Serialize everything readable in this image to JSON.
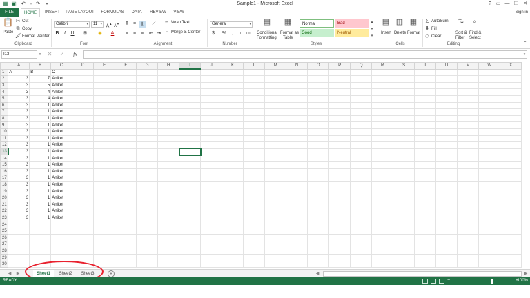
{
  "window": {
    "title": "Sample1 - Microsoft Excel",
    "signin": "Sign in"
  },
  "menu": {
    "file": "FILE",
    "tabs": [
      "HOME",
      "INSERT",
      "PAGE LAYOUT",
      "FORMULAS",
      "DATA",
      "REVIEW",
      "VIEW"
    ],
    "active": "HOME"
  },
  "ribbon": {
    "clipboard": {
      "paste": "Paste",
      "cut": "Cut",
      "copy": "Copy",
      "format_painter": "Format Painter",
      "label": "Clipboard"
    },
    "font": {
      "name": "Calibri",
      "size": "11",
      "label": "Font"
    },
    "alignment": {
      "wrap_text": "Wrap Text",
      "merge_center": "Merge & Center",
      "label": "Alignment"
    },
    "number": {
      "format": "General",
      "label": "Number"
    },
    "styles": {
      "conditional_formatting_1": "Conditional",
      "conditional_formatting_2": "Formatting",
      "format_as_table_1": "Format as",
      "format_as_table_2": "Table",
      "normal": "Normal",
      "bad": "Bad",
      "good": "Good",
      "neutral": "Neutral",
      "label": "Styles",
      "colors": {
        "normal_bg": "#ffffff",
        "bad_bg": "#ffc7ce",
        "bad_fg": "#9c0006",
        "good_bg": "#c6efce",
        "good_fg": "#006100",
        "neutral_bg": "#ffeb9c",
        "neutral_fg": "#9c5700"
      }
    },
    "cells": {
      "insert": "Insert",
      "delete": "Delete",
      "format": "Format",
      "label": "Cells"
    },
    "editing": {
      "autosum": "AutoSum",
      "fill": "Fill",
      "clear": "Clear",
      "sort_filter_1": "Sort &",
      "sort_filter_2": "Filter",
      "find_select_1": "Find &",
      "find_select_2": "Select",
      "label": "Editing"
    }
  },
  "formula_bar": {
    "name_box": "I13",
    "value": ""
  },
  "grid": {
    "columns": [
      "A",
      "B",
      "C",
      "D",
      "E",
      "F",
      "G",
      "H",
      "I",
      "J",
      "K",
      "L",
      "M",
      "N",
      "O",
      "P",
      "Q",
      "R",
      "S",
      "T",
      "U",
      "V",
      "W",
      "X"
    ],
    "selected_column": "I",
    "selected_row": 13,
    "row_count": 30,
    "header": [
      "A",
      "B",
      "C"
    ],
    "rows": [
      [
        3,
        7,
        "Aniket"
      ],
      [
        3,
        5,
        "Aniket"
      ],
      [
        3,
        4,
        "Aniket"
      ],
      [
        3,
        4,
        "Aniket"
      ],
      [
        3,
        1,
        "Aniket"
      ],
      [
        3,
        1,
        "Aniket"
      ],
      [
        3,
        1,
        "Aniket"
      ],
      [
        3,
        1,
        "Aniket"
      ],
      [
        3,
        1,
        "Aniket"
      ],
      [
        3,
        1,
        "Aniket"
      ],
      [
        3,
        1,
        "Aniket"
      ],
      [
        3,
        1,
        "Aniket"
      ],
      [
        3,
        1,
        "Aniket"
      ],
      [
        3,
        1,
        "Aniket"
      ],
      [
        3,
        1,
        "Aniket"
      ],
      [
        3,
        1,
        "Aniket"
      ],
      [
        3,
        1,
        "Aniket"
      ],
      [
        3,
        1,
        "Aniket"
      ],
      [
        3,
        1,
        "Aniket"
      ],
      [
        3,
        1,
        "Aniket"
      ],
      [
        3,
        1,
        "Aniket"
      ],
      [
        3,
        1,
        "Aniket"
      ]
    ]
  },
  "sheets": {
    "tabs": [
      "Sheet1",
      "Sheet2",
      "Sheet3"
    ],
    "active": "Sheet1"
  },
  "status": {
    "ready": "READY",
    "zoom": "100%"
  },
  "colors": {
    "accent": "#217346",
    "annotation": "#e8212e"
  }
}
